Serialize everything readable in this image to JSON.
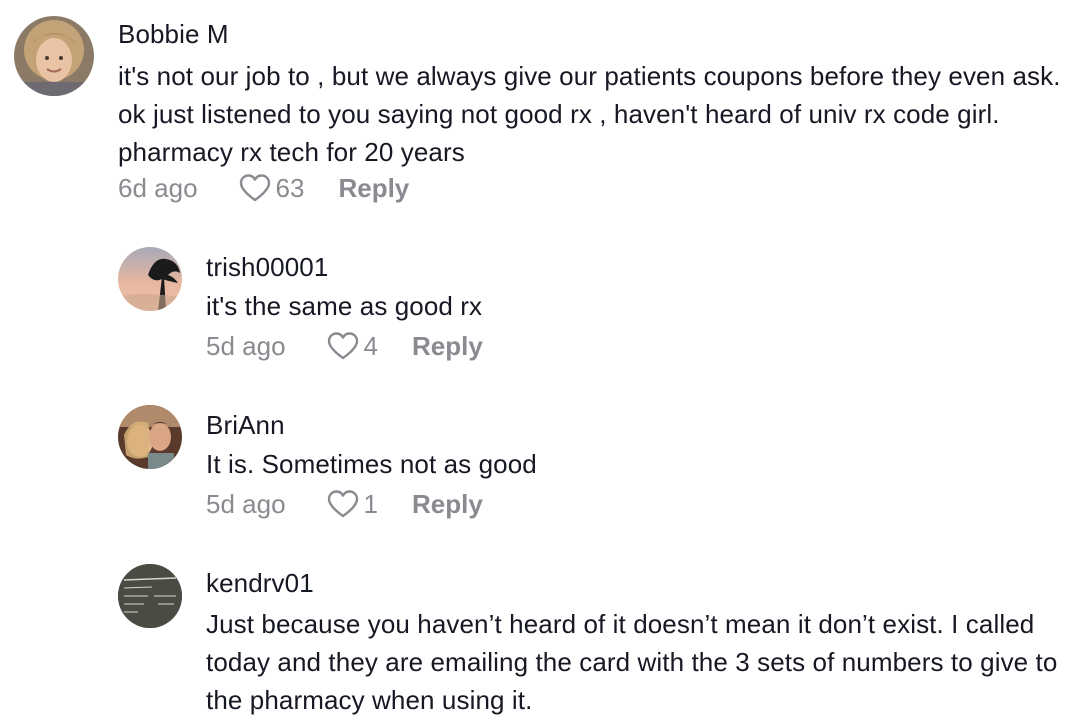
{
  "comments": [
    {
      "username": "Bobbie M",
      "text": "it's not our job to , but we always give our patients coupons before they even ask. ok just listened to you saying not good rx , haven't heard of univ rx code girl. pharmacy rx tech for 20 years",
      "time": "6d ago",
      "likes": "63",
      "reply_label": "Reply"
    },
    {
      "username": "trish00001",
      "text": "it's the same as good rx",
      "time": "5d ago",
      "likes": "4",
      "reply_label": "Reply"
    },
    {
      "username": "BriAnn",
      "text": "It is. Sometimes not as good",
      "time": "5d ago",
      "likes": "1",
      "reply_label": "Reply"
    },
    {
      "username": "kendrv01",
      "text": "Just because you haven’t heard of it doesn’t mean it don’t exist. I called today and they are emailing the card with the 3 sets of numbers to give to the pharmacy when using it.",
      "time": "",
      "likes": "",
      "reply_label": ""
    }
  ],
  "colors": {
    "text": "#161823",
    "meta": "#8a8b91",
    "background": "#ffffff"
  },
  "icons": {
    "like": "heart-outline-icon"
  }
}
